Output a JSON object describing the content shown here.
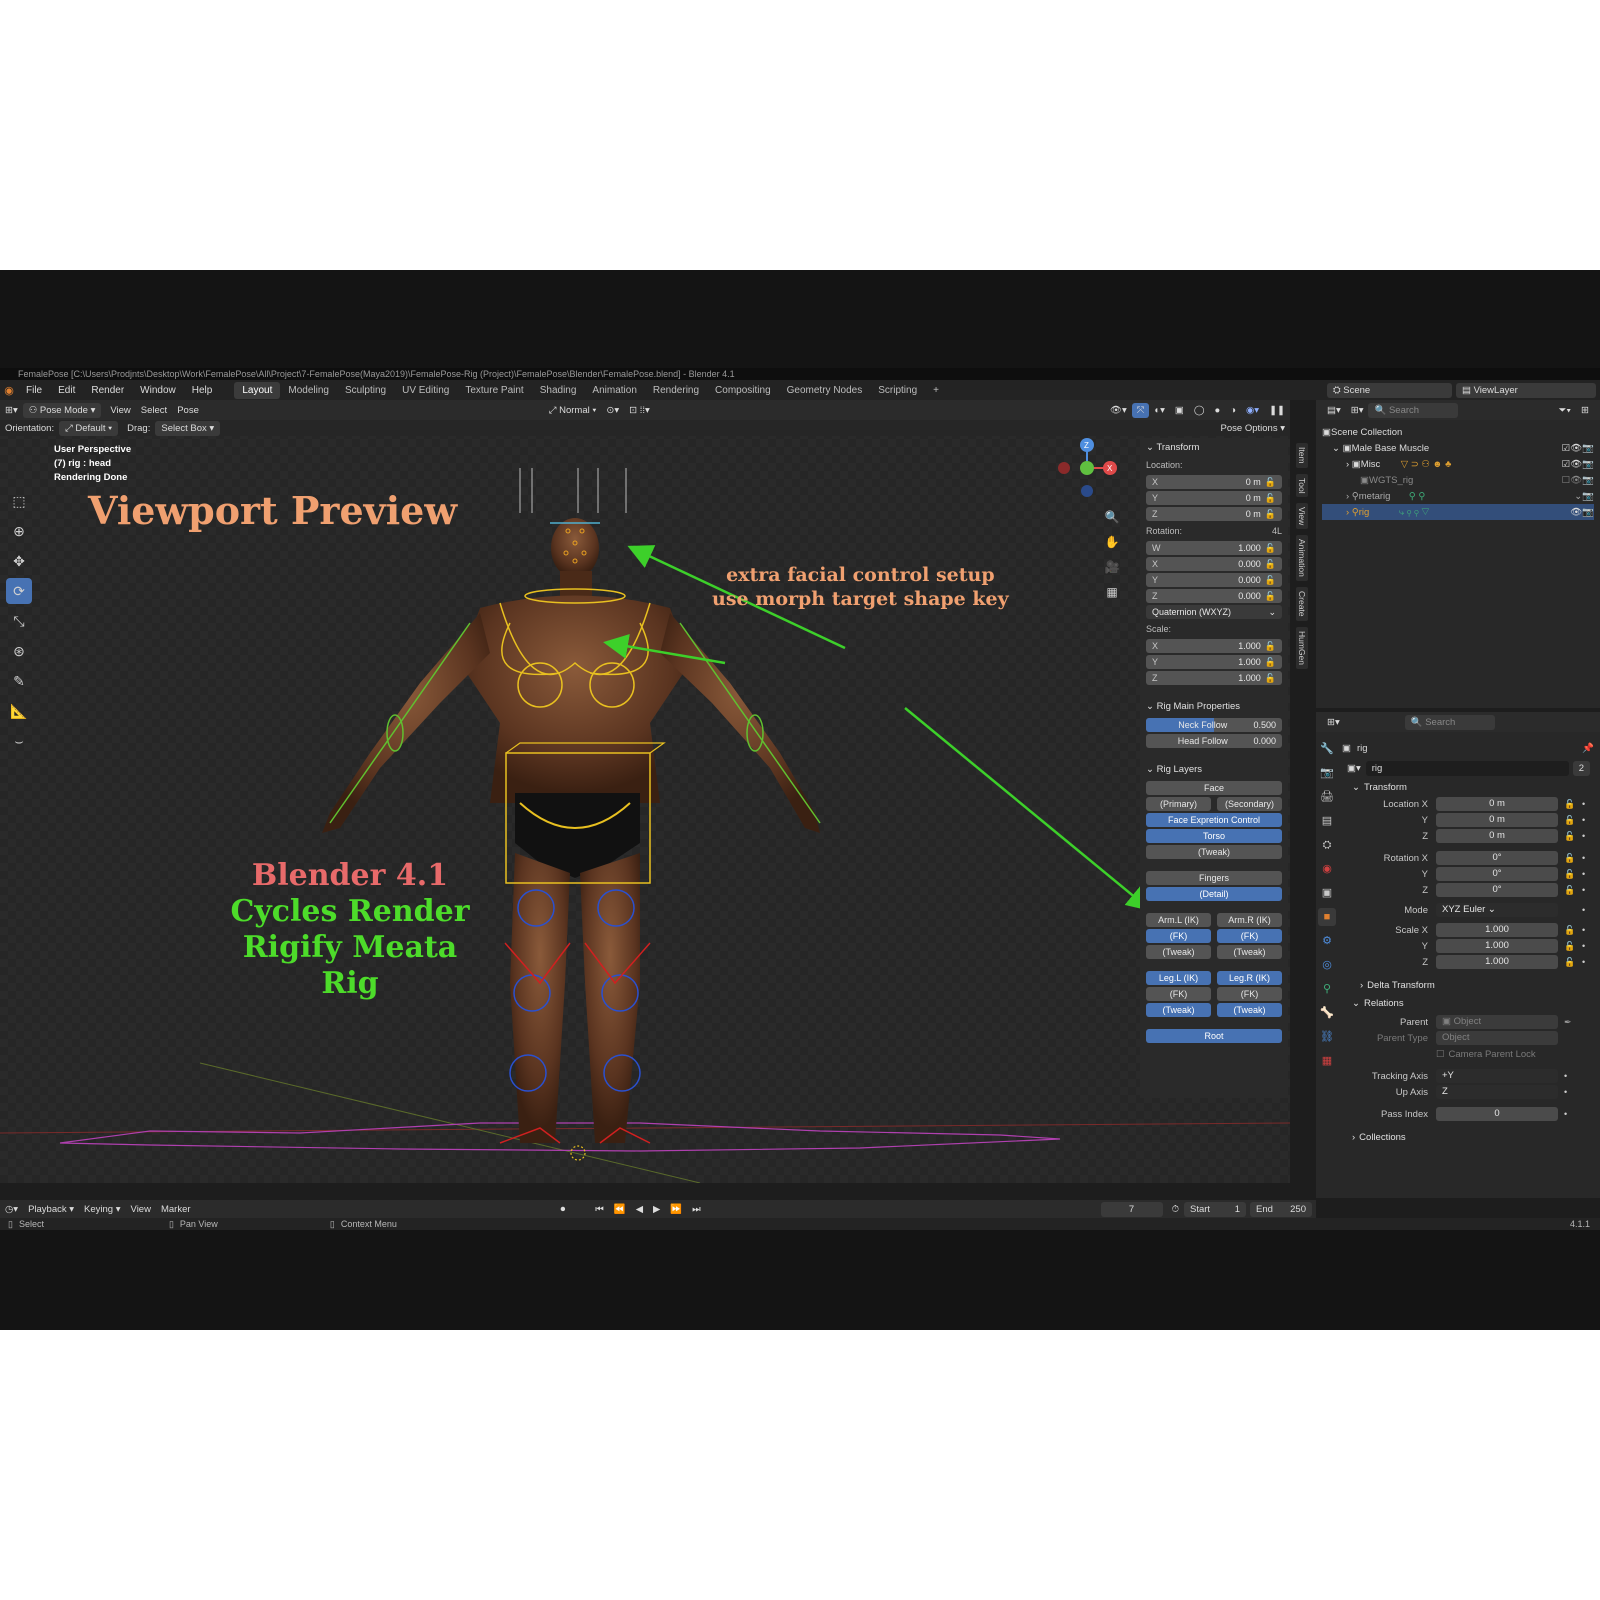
{
  "window": {
    "title": "FemalePose [C:\\Users\\Prodjnts\\Desktop\\Work\\FemalePose\\All\\Project\\7-FemalePose(Maya2019)\\FemalePose-Rig (Project)\\FemalePose\\Blender\\FemalePose.blend] - Blender 4.1"
  },
  "menu": {
    "items": [
      "File",
      "Edit",
      "Render",
      "Window",
      "Help"
    ]
  },
  "workspaces": [
    "Layout",
    "Modeling",
    "Sculpting",
    "UV Editing",
    "Texture Paint",
    "Shading",
    "Animation",
    "Rendering",
    "Compositing",
    "Geometry Nodes",
    "Scripting",
    "+"
  ],
  "scene": {
    "scene_name": "Scene",
    "view_layer": "ViewLayer"
  },
  "viewport_header": {
    "mode": "Pose Mode",
    "menus": [
      "View",
      "Select",
      "Pose"
    ],
    "transform_orientation": "Normal",
    "orientation_label": "Orientation:",
    "orientation_value": "Default",
    "drag_label": "Drag:",
    "drag_value": "Select Box",
    "pose_options": "Pose Options"
  },
  "viewport_info": {
    "line1": "User Perspective",
    "line2": "(7) rig : head",
    "line3": "Rendering Done"
  },
  "overlays": {
    "title": "Viewport Preview",
    "annotation_line1": "extra facial control setup",
    "annotation_line2": "use morph target shape key",
    "blender_version": "Blender 4.1",
    "render_engine": "Cycles Render",
    "rig_name": "Rigify Meata Rig",
    "colors": {
      "title": "#f0a070",
      "annotation": "#f0a070",
      "version": "#e86a6a",
      "green": "#4ddc2a",
      "arrow": "#3dd02a"
    }
  },
  "npanel": {
    "transform_title": "Transform",
    "location_label": "Location:",
    "location": [
      {
        "k": "X",
        "v": "0 m"
      },
      {
        "k": "Y",
        "v": "0 m"
      },
      {
        "k": "Z",
        "v": "0 m"
      }
    ],
    "rotation_label": "Rotation:",
    "rotation_mode_short": "4L",
    "rotation": [
      {
        "k": "W",
        "v": "1.000"
      },
      {
        "k": "X",
        "v": "0.000"
      },
      {
        "k": "Y",
        "v": "0.000"
      },
      {
        "k": "Z",
        "v": "0.000"
      }
    ],
    "rotation_mode": "Quaternion (WXYZ)",
    "scale_label": "Scale:",
    "scale": [
      {
        "k": "X",
        "v": "1.000"
      },
      {
        "k": "Y",
        "v": "1.000"
      },
      {
        "k": "Z",
        "v": "1.000"
      }
    ],
    "rig_main_title": "Rig Main Properties",
    "neck_follow_label": "Neck Follow",
    "neck_follow_value": "0.500",
    "neck_follow_fraction": 0.5,
    "head_follow_label": "Head Follow",
    "head_follow_value": "0.000",
    "rig_layers_title": "Rig Layers",
    "layers": {
      "face": "Face",
      "primary": "(Primary)",
      "secondary": "(Secondary)",
      "face_expr": "Face Expretion Control",
      "torso": "Torso",
      "tweak": "(Tweak)",
      "fingers": "Fingers",
      "detail": "(Detail)",
      "arm_l_ik": "Arm.L (IK)",
      "arm_r_ik": "Arm.R (IK)",
      "fk_l": "(FK)",
      "fk_r": "(FK)",
      "tweak_l": "(Tweak)",
      "tweak_r": "(Tweak)",
      "leg_l_ik": "Leg.L (IK)",
      "leg_r_ik": "Leg.R (IK)",
      "leg_fk_l": "(FK)",
      "leg_fk_r": "(FK)",
      "leg_tweak_l": "(Tweak)",
      "leg_tweak_r": "(Tweak)",
      "root": "Root"
    },
    "side_tabs": [
      "Item",
      "Tool",
      "View",
      "Animation",
      "Create",
      "HumGen"
    ]
  },
  "outliner": {
    "search_placeholder": "Search",
    "items": [
      {
        "label": "Scene Collection"
      },
      {
        "label": "Male Base Muscle"
      },
      {
        "label": "Misc"
      },
      {
        "label": "WGTS_rig"
      },
      {
        "label": "metarig"
      },
      {
        "label": "rig"
      }
    ]
  },
  "properties": {
    "search_placeholder": "Search",
    "object_name": "rig",
    "data_name": "rig",
    "users": "2",
    "transform_title": "Transform",
    "location_x_label": "Location X",
    "y_label": "Y",
    "z_label": "Z",
    "location": [
      "0 m",
      "0 m",
      "0 m"
    ],
    "rotation_x_label": "Rotation X",
    "rotation": [
      "0°",
      "0°",
      "0°"
    ],
    "mode_label": "Mode",
    "mode_value": "XYZ Euler",
    "scale_x_label": "Scale X",
    "scale": [
      "1.000",
      "1.000",
      "1.000"
    ],
    "delta_title": "Delta Transform",
    "relations_title": "Relations",
    "parent_label": "Parent",
    "parent_placeholder": "Object",
    "parent_type_label": "Parent Type",
    "parent_type_value": "Object",
    "camera_parent_lock": "Camera Parent Lock",
    "tracking_axis_label": "Tracking Axis",
    "tracking_axis_value": "+Y",
    "up_axis_label": "Up Axis",
    "up_axis_value": "Z",
    "pass_index_label": "Pass Index",
    "pass_index_value": "0",
    "collections_title": "Collections"
  },
  "timeline": {
    "menus": [
      "Playback",
      "Keying",
      "View",
      "Marker"
    ],
    "current_frame": "7",
    "start_label": "Start",
    "start_value": "1",
    "end_label": "End",
    "end_value": "250"
  },
  "statusbar": {
    "select": "Select",
    "pan": "Pan View",
    "context": "Context Menu",
    "version": "4.1.1"
  }
}
